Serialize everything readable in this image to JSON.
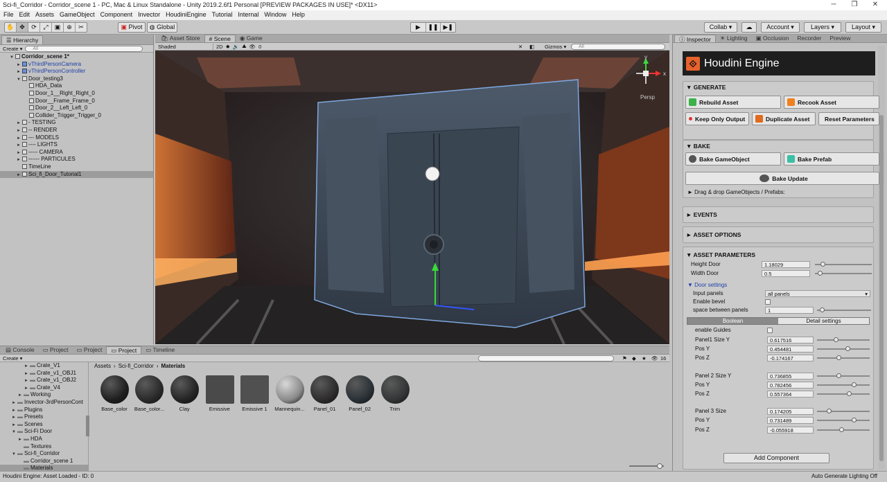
{
  "window": {
    "title": "Sci-fi_Corridor - Corridor_scene 1 - PC, Mac & Linux Standalone - Unity 2019.2.6f1 Personal [PREVIEW PACKAGES IN USE]* <DX11>"
  },
  "menu": [
    "File",
    "Edit",
    "Assets",
    "GameObject",
    "Component",
    "Invector",
    "HoudiniEngine",
    "Tutorial",
    "Internal",
    "Window",
    "Help"
  ],
  "toolbar": {
    "pivot": "Pivot",
    "global": "Global",
    "collab": "Collab ▾",
    "account": "Account ▾",
    "layers": "Layers ▾",
    "layout": "Layout ▾"
  },
  "hierarchy": {
    "tab": "Hierarchy",
    "create": "Create ▾",
    "search_placeholder": "All",
    "items": [
      {
        "label": "Corridor_scene 1*",
        "indent": 0,
        "bold": true,
        "arrow": "▼",
        "icon": "scene"
      },
      {
        "label": "vThirdPersonCamera",
        "indent": 1,
        "blue": true,
        "arrow": "►"
      },
      {
        "label": "vThirdPersonController",
        "indent": 1,
        "blue": true,
        "arrow": "►"
      },
      {
        "label": "Door_testing3",
        "indent": 1,
        "arrow": "▼"
      },
      {
        "label": "HDA_Data",
        "indent": 2
      },
      {
        "label": "Door_1__Right_Right_0",
        "indent": 2
      },
      {
        "label": "Door__Frame_Frame_0",
        "indent": 2
      },
      {
        "label": "Door_2__Left_Left_0",
        "indent": 2
      },
      {
        "label": "Collider_Trigger_Trigger_0",
        "indent": 2
      },
      {
        "label": "- TESTING",
        "indent": 1,
        "arrow": "►"
      },
      {
        "label": "-- RENDER",
        "indent": 1,
        "arrow": "►"
      },
      {
        "label": "--- MODELS",
        "indent": 1,
        "arrow": "►"
      },
      {
        "label": "---- LIGHTS",
        "indent": 1,
        "arrow": "►"
      },
      {
        "label": "----- CAMERA",
        "indent": 1,
        "arrow": "►"
      },
      {
        "label": "------ PARTICULES",
        "indent": 1,
        "arrow": "►"
      },
      {
        "label": "TimeLine",
        "indent": 1
      },
      {
        "label": "Sci_fi_Door_Tutorial1",
        "indent": 1,
        "arrow": "►",
        "selected": true
      }
    ]
  },
  "scene": {
    "tabs": [
      "Asset Store",
      "Scene",
      "Game"
    ],
    "active_tab": "Scene",
    "shading": "Shaded",
    "mode_2d": "2D",
    "gizmos": "Gizmos ▾",
    "search_placeholder": "All",
    "fx_count": "0",
    "persp": "Persp",
    "axis_y": "y",
    "axis_x": "x"
  },
  "project": {
    "tabs": [
      "Console",
      "Project",
      "Project",
      "Project",
      "Timeline"
    ],
    "create": "Create ▾",
    "breadcrumb": [
      "Assets",
      "Sci-fi_Corridor",
      "Materials"
    ],
    "count": "16",
    "tree": [
      {
        "label": "Crate_V1",
        "indent": 3,
        "arrow": "►"
      },
      {
        "label": "Crate_v1_OBJ1",
        "indent": 3,
        "arrow": "►"
      },
      {
        "label": "Crate_v1_OBJ2",
        "indent": 3,
        "arrow": "►"
      },
      {
        "label": "Crate_V4",
        "indent": 3,
        "arrow": "►"
      },
      {
        "label": "Working",
        "indent": 2,
        "arrow": "►"
      },
      {
        "label": "Invector-3rdPersonCont",
        "indent": 1,
        "arrow": "►"
      },
      {
        "label": "Plugins",
        "indent": 1,
        "arrow": "►"
      },
      {
        "label": "Presets",
        "indent": 1,
        "arrow": "►"
      },
      {
        "label": "Scenes",
        "indent": 1,
        "arrow": "►"
      },
      {
        "label": "Sci-Fi Door",
        "indent": 1,
        "arrow": "▼"
      },
      {
        "label": "HDA",
        "indent": 2,
        "arrow": "►"
      },
      {
        "label": "Textures",
        "indent": 2
      },
      {
        "label": "Sci-fi_Corridor",
        "indent": 1,
        "arrow": "▼"
      },
      {
        "label": "Corridor_scene 1",
        "indent": 2
      },
      {
        "label": "Materials",
        "indent": 2,
        "selected": true
      }
    ],
    "materials": [
      {
        "label": "Base_color",
        "color": "#1e1e1e"
      },
      {
        "label": "Base_color...",
        "color": "#2a2a2a"
      },
      {
        "label": "Clay",
        "color": "#242424"
      },
      {
        "label": "Emissive",
        "color": "#4a4a4a"
      },
      {
        "label": "Emissive 1",
        "color": "#505050"
      },
      {
        "label": "Mannequin...",
        "color": "#8a8a8a"
      },
      {
        "label": "Panel_01",
        "color": "#2d2b2b"
      },
      {
        "label": "Panel_02",
        "color": "#2a3136"
      },
      {
        "label": "Trim",
        "color": "#333536"
      }
    ]
  },
  "inspector": {
    "tabs": [
      "Inspector",
      "Lighting",
      "Occlusion",
      "Recorder",
      "Preview"
    ],
    "header": "Houdini Engine",
    "generate": {
      "title": "GENERATE",
      "rebuild": "Rebuild Asset",
      "recook": "Recook Asset",
      "keep_only": "Keep Only Output",
      "duplicate": "Duplicate Asset",
      "reset": "Reset Parameters"
    },
    "bake": {
      "title": "BAKE",
      "bake_go": "Bake GameObject",
      "bake_prefab": "Bake Prefab",
      "bake_update": "Bake Update",
      "drag_drop": "Drag & drop GameObjects / Prefabs:"
    },
    "events": "EVENTS",
    "asset_options": "ASSET OPTIONS",
    "params": {
      "title": "ASSET PARAMETERS",
      "height_label": "Height Door",
      "height_value": "1.18029",
      "height_frac": 0.1,
      "width_label": "Width Door",
      "width_value": "0.5",
      "width_frac": 0.05,
      "door_settings": "Door settings",
      "input_panels_label": "Input panels",
      "input_panels_value": "all panels",
      "enable_bevel_label": "Enable bevel",
      "space_label": "space between panels",
      "space_value": "1",
      "space_frac": 0.05,
      "tab_boolean": "Boolean",
      "tab_detail": "Detail settings",
      "enable_guides_label": "enable Guides",
      "rows": [
        {
          "label": "Panel1 Size Y",
          "value": "0.617516",
          "frac": 0.35,
          "gap": false
        },
        {
          "label": "Pos Y",
          "value": "0.454481",
          "frac": 0.6,
          "gap": false
        },
        {
          "label": "Pos Z",
          "value": "-0.174167",
          "frac": 0.4,
          "gap": false
        },
        {
          "label": "Panel 2 Size Y",
          "value": "0.736855",
          "frac": 0.4,
          "gap": true
        },
        {
          "label": "Pos Y",
          "value": "0.782456",
          "frac": 0.73,
          "gap": false
        },
        {
          "label": "Pos Z",
          "value": "0.557364",
          "frac": 0.63,
          "gap": false
        },
        {
          "label": "Panel 3 Size",
          "value": "0.174205",
          "frac": 0.2,
          "gap": true
        },
        {
          "label": "Pos Y",
          "value": "0.731489",
          "frac": 0.72,
          "gap": false
        },
        {
          "label": "Pos Z",
          "value": "-0.055918",
          "frac": 0.47,
          "gap": false
        }
      ]
    },
    "add_component": "Add Component"
  },
  "status": {
    "left": "Houdini Engine: Asset Loaded - ID: 0",
    "right": "Auto Generate Lighting Off"
  }
}
